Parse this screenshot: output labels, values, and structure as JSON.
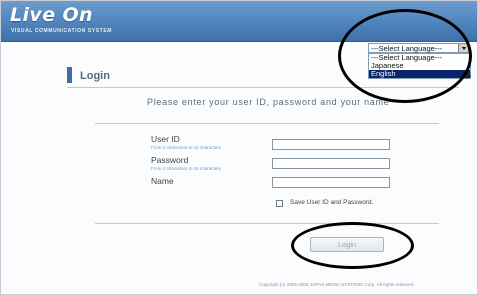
{
  "header": {
    "logo": "Live On",
    "tagline": "VISUAL COMMUNICATION SYSTEM"
  },
  "language": {
    "selected": "---Select Language---",
    "options": [
      "---Select Language---",
      "Japanese",
      "English"
    ],
    "highlighted": "English"
  },
  "login": {
    "title": "Login",
    "instruction": "Please enter your user ID, password and your name",
    "user_id_label": "User ID",
    "user_id_hint": "From 4 characters to 16 characters",
    "password_label": "Password",
    "password_hint": "From 4 characters to 16 characters",
    "name_label": "Name",
    "save_label": "Save User ID and Password.",
    "button_label": "Login"
  },
  "footer": {
    "copyright": "Copyright (c) 2004-2006 JAPAN MEDIA SYSTEMS Corp. All rights reserved."
  },
  "colors": {
    "header": "#4f84bd",
    "accent": "#3e6fa8",
    "highlight": "#0a246a"
  }
}
